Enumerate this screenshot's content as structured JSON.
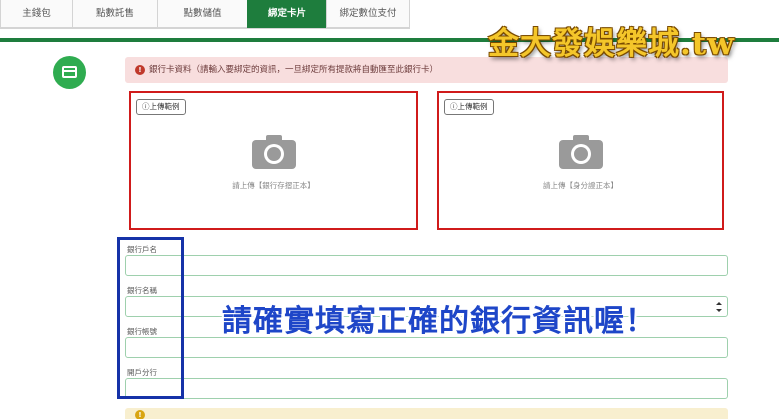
{
  "tabs": [
    {
      "label": "主錢包",
      "active": false
    },
    {
      "label": "點數託售",
      "active": false
    },
    {
      "label": "點數儲值",
      "active": false
    },
    {
      "label": "綁定卡片",
      "active": true
    },
    {
      "label": "綁定數位支付",
      "active": false
    }
  ],
  "brand": {
    "text": "金大發娛樂城.tw",
    "color": "#f4c62a"
  },
  "accent_color": "#1e7d3d",
  "section_icon": "credit-card-icon",
  "alert": {
    "icon": "exclamation-icon",
    "symbol": "!",
    "text": "銀行卡資料（請輸入要綁定的資訊，一旦綁定所有提款將自動匯至此銀行卡）"
  },
  "uploads": [
    {
      "example_label": "上傳範例",
      "hint": "請上傳【銀行存摺正本】",
      "icon": "camera-icon"
    },
    {
      "example_label": "上傳範例",
      "hint": "請上傳【身分證正本】",
      "icon": "camera-icon"
    }
  ],
  "form": {
    "account_name_label": "銀行戶名",
    "account_name_value": "",
    "bank_name_label": "銀行名稱",
    "bank_name_value": "",
    "account_number_label": "銀行帳號",
    "account_number_value": "",
    "branch_label": "開戶分行",
    "branch_value": ""
  },
  "overlay_caption": "請確實填寫正確的銀行資訊喔！",
  "bottom_notice": {
    "symbol": "!",
    "text": ""
  }
}
